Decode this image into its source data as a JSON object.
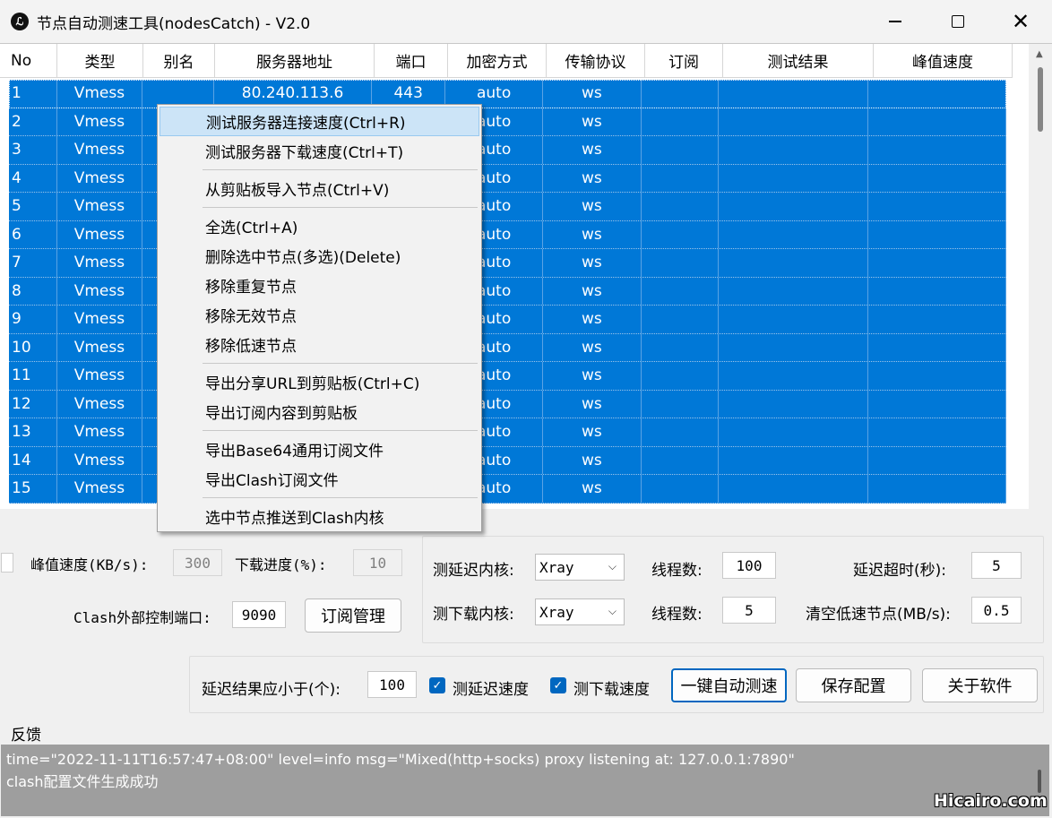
{
  "window": {
    "title": "节点自动测速工具(nodesCatch) - V2.0",
    "icon": "app-logo-icon",
    "controls": [
      "minimize-icon",
      "maximize-icon",
      "close-icon"
    ]
  },
  "table": {
    "columns": [
      "No",
      "类型",
      "别名",
      "服务器地址",
      "端口",
      "加密方式",
      "传输协议",
      "订阅",
      "测试结果",
      "峰值速度"
    ],
    "rows": [
      {
        "no": "1",
        "type": "Vmess",
        "alias": "",
        "server": "80.240.113.6",
        "port": "443",
        "enc": "auto",
        "proto": "ws",
        "sub": "",
        "result": "",
        "speed": ""
      },
      {
        "no": "2",
        "type": "Vmess",
        "alias": "",
        "server": "",
        "port": "",
        "enc": "auto",
        "proto": "ws",
        "sub": "",
        "result": "",
        "speed": ""
      },
      {
        "no": "3",
        "type": "Vmess",
        "alias": "",
        "server": "",
        "port": "",
        "enc": "auto",
        "proto": "ws",
        "sub": "",
        "result": "",
        "speed": ""
      },
      {
        "no": "4",
        "type": "Vmess",
        "alias": "",
        "server": "",
        "port": "",
        "enc": "auto",
        "proto": "ws",
        "sub": "",
        "result": "",
        "speed": ""
      },
      {
        "no": "5",
        "type": "Vmess",
        "alias": "",
        "server": "",
        "port": "",
        "enc": "auto",
        "proto": "ws",
        "sub": "",
        "result": "",
        "speed": ""
      },
      {
        "no": "6",
        "type": "Vmess",
        "alias": "",
        "server": "",
        "port": "",
        "enc": "auto",
        "proto": "ws",
        "sub": "",
        "result": "",
        "speed": ""
      },
      {
        "no": "7",
        "type": "Vmess",
        "alias": "",
        "server": "",
        "port": "",
        "enc": "auto",
        "proto": "ws",
        "sub": "",
        "result": "",
        "speed": ""
      },
      {
        "no": "8",
        "type": "Vmess",
        "alias": "",
        "server": "",
        "port": "",
        "enc": "auto",
        "proto": "ws",
        "sub": "",
        "result": "",
        "speed": ""
      },
      {
        "no": "9",
        "type": "Vmess",
        "alias": "",
        "server": "",
        "port": "",
        "enc": "auto",
        "proto": "ws",
        "sub": "",
        "result": "",
        "speed": ""
      },
      {
        "no": "10",
        "type": "Vmess",
        "alias": "",
        "server": "",
        "port": "",
        "enc": "auto",
        "proto": "ws",
        "sub": "",
        "result": "",
        "speed": ""
      },
      {
        "no": "11",
        "type": "Vmess",
        "alias": "",
        "server": "",
        "port": "",
        "enc": "auto",
        "proto": "ws",
        "sub": "",
        "result": "",
        "speed": ""
      },
      {
        "no": "12",
        "type": "Vmess",
        "alias": "",
        "server": "",
        "port": "",
        "enc": "auto",
        "proto": "ws",
        "sub": "",
        "result": "",
        "speed": ""
      },
      {
        "no": "13",
        "type": "Vmess",
        "alias": "",
        "server": "",
        "port": "",
        "enc": "auto",
        "proto": "ws",
        "sub": "",
        "result": "",
        "speed": ""
      },
      {
        "no": "14",
        "type": "Vmess",
        "alias": "",
        "server": "",
        "port": "",
        "enc": "auto",
        "proto": "ws",
        "sub": "",
        "result": "",
        "speed": ""
      },
      {
        "no": "15",
        "type": "Vmess",
        "alias": "",
        "server": "",
        "port": "",
        "enc": "auto",
        "proto": "ws",
        "sub": "",
        "result": "",
        "speed": ""
      }
    ],
    "selection_color": "#0078d7"
  },
  "context_menu": {
    "groups": [
      [
        "测试服务器连接速度(Ctrl+R)",
        "测试服务器下载速度(Ctrl+T)"
      ],
      [
        "从剪贴板导入节点(Ctrl+V)"
      ],
      [
        "全选(Ctrl+A)",
        "删除选中节点(多选)(Delete)",
        "移除重复节点",
        "移除无效节点",
        "移除低速节点"
      ],
      [
        "导出分享URL到剪贴板(Ctrl+C)",
        "导出订阅内容到剪贴板"
      ],
      [
        "导出Base64通用订阅文件",
        "导出Clash订阅文件"
      ],
      [
        "选中节点推送到Clash内核"
      ]
    ],
    "highlighted": "测试服务器连接速度(Ctrl+R)"
  },
  "left_panel": {
    "peak_speed_label": "峰值速度(KB/s):",
    "peak_speed_value": "300",
    "download_progress_label": "下载进度(%):",
    "download_progress_value": "10",
    "clash_port_label": "Clash外部控制端口:",
    "clash_port_value": "9090",
    "subscription_button": "订阅管理"
  },
  "right_panel": {
    "latency_core_label": "测延迟内核:",
    "latency_core_value": "Xray",
    "latency_threads_label": "线程数:",
    "latency_threads_value": "100",
    "timeout_label": "延迟超时(秒):",
    "timeout_value": "5",
    "download_core_label": "测下载内核:",
    "download_core_value": "Xray",
    "download_threads_label": "线程数:",
    "download_threads_value": "5",
    "clear_slow_label": "清空低速节点(MB/s):",
    "clear_slow_value": "0.5"
  },
  "action_bar": {
    "latency_limit_label": "延迟结果应小于(个):",
    "latency_limit_value": "100",
    "test_latency_label": "测延迟速度",
    "test_latency_checked": true,
    "test_download_label": "测下载速度",
    "test_download_checked": true,
    "auto_test_button": "一键自动测速",
    "save_config_button": "保存配置",
    "about_button": "关于软件"
  },
  "feedback": {
    "title": "反馈",
    "lines": [
      "time=\"2022-11-11T16:57:47+08:00\" level=info msg=\"Mixed(http+socks) proxy listening at: 127.0.0.1:7890\"",
      "clash配置文件生成成功"
    ]
  },
  "watermark": "Hicairo.com"
}
